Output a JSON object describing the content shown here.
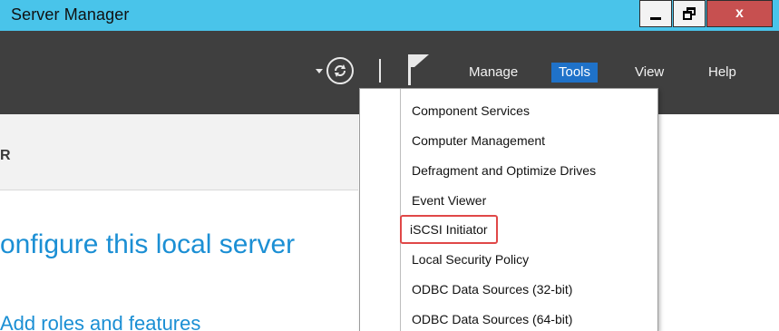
{
  "window": {
    "title": "Server Manager",
    "buttons": {
      "close_label": "x"
    }
  },
  "toolbar": {
    "menus": [
      "Manage",
      "Tools",
      "View",
      "Help"
    ],
    "active_menu": "Tools"
  },
  "content": {
    "section_fragment": "R",
    "heading_fragment": "onfigure this local server",
    "link_fragment": "Add roles and features"
  },
  "tools_menu": {
    "items": [
      "Component Services",
      "Computer Management",
      "Defragment and Optimize Drives",
      "Event Viewer",
      "iSCSI Initiator",
      "Local Security Policy",
      "ODBC Data Sources (32-bit)",
      "ODBC Data Sources (64-bit)"
    ],
    "highlighted_item": "iSCSI Initiator"
  },
  "colors": {
    "titlebar": "#49c4ea",
    "header": "#3f3f3f",
    "accent": "#1f72c9",
    "link": "#1b8fd4",
    "close": "#c75050",
    "highlight_outline": "#e04848"
  },
  "icons": [
    "refresh-icon",
    "flag-icon",
    "dropdown-arrow-icon",
    "minimize-icon",
    "restore-icon",
    "close-icon"
  ]
}
